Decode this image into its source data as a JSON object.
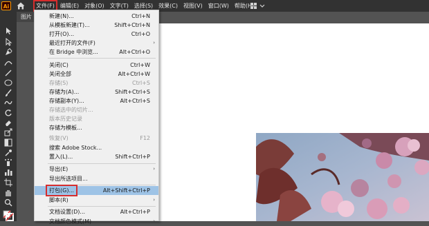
{
  "app": {
    "logo": "Ai",
    "home_icon": "home-icon"
  },
  "menubar": [
    {
      "label": "文件(F)"
    },
    {
      "label": "编辑(E)"
    },
    {
      "label": "对象(O)"
    },
    {
      "label": "文字(T)"
    },
    {
      "label": "选择(S)"
    },
    {
      "label": "效果(C)"
    },
    {
      "label": "视图(V)"
    },
    {
      "label": "窗口(W)"
    },
    {
      "label": "帮助(H)"
    }
  ],
  "document": {
    "tab_label": "图片"
  },
  "file_menu": {
    "items": [
      {
        "label": "新建(N)...",
        "shortcut": "Ctrl+N"
      },
      {
        "label": "从模板新建(T)...",
        "shortcut": "Shift+Ctrl+N"
      },
      {
        "label": "打开(O)...",
        "shortcut": "Ctrl+O"
      },
      {
        "label": "最近打开的文件(F)",
        "shortcut": "",
        "arrow": "›"
      },
      {
        "label": "在 Bridge 中浏览...",
        "shortcut": "Alt+Ctrl+O"
      },
      {
        "label": "关闭(C)",
        "shortcut": "Ctrl+W"
      },
      {
        "label": "关闭全部",
        "shortcut": "Alt+Ctrl+W"
      },
      {
        "label": "存储(S)",
        "shortcut": "Ctrl+S"
      },
      {
        "label": "存储为(A)...",
        "shortcut": "Shift+Ctrl+S"
      },
      {
        "label": "存储副本(Y)...",
        "shortcut": "Alt+Ctrl+S"
      },
      {
        "label": "存储选中的切片...",
        "shortcut": ""
      },
      {
        "label": "版本历史记录",
        "shortcut": ""
      },
      {
        "label": "存储为模板...",
        "shortcut": ""
      },
      {
        "label": "恢复(V)",
        "shortcut": "F12"
      },
      {
        "label": "搜索 Adobe Stock...",
        "shortcut": ""
      },
      {
        "label": "置入(L)...",
        "shortcut": "Shift+Ctrl+P"
      },
      {
        "label": "导出(E)",
        "shortcut": "",
        "arrow": "›"
      },
      {
        "label": "导出所选项目...",
        "shortcut": ""
      },
      {
        "label": "打包(G)...",
        "shortcut": "Alt+Shift+Ctrl+P"
      },
      {
        "label": "脚本(R)",
        "shortcut": "",
        "arrow": "›"
      },
      {
        "label": "文档设置(D)...",
        "shortcut": "Alt+Ctrl+P"
      },
      {
        "label": "文档颜色模式(M)",
        "shortcut": "",
        "arrow": "›"
      }
    ]
  },
  "colors": {
    "menubar_bg": "#323232",
    "canvas_bg": "#535353",
    "menu_bg": "#f0f0f0",
    "highlight": "#9ec3e6",
    "annotation_red": "#d62d2d",
    "logo_orange": "#ff9a00"
  }
}
